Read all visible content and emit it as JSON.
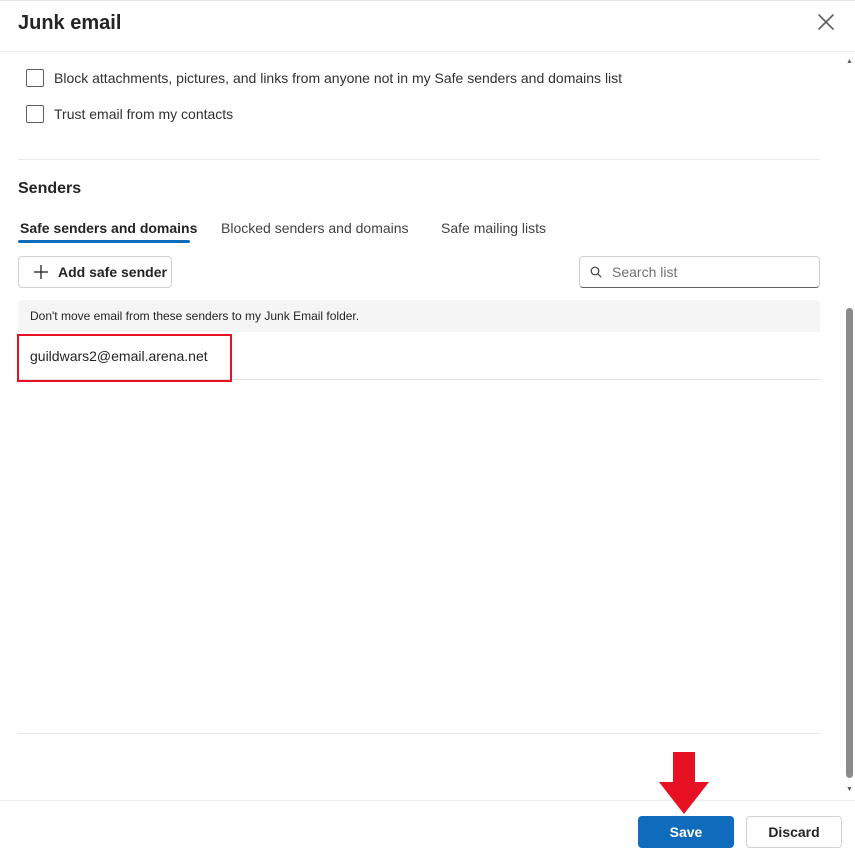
{
  "dialog": {
    "title": "Junk email",
    "close_icon": "close-icon"
  },
  "options": {
    "block_attachments": {
      "label": "Block attachments, pictures, and links from anyone not in my Safe senders and domains list",
      "checked": false
    },
    "trust_contacts": {
      "label": "Trust email from my contacts",
      "checked": false
    }
  },
  "senders": {
    "heading": "Senders",
    "tabs": [
      {
        "label": "Safe senders and domains",
        "active": true
      },
      {
        "label": "Blocked senders and domains",
        "active": false
      },
      {
        "label": "Safe mailing lists",
        "active": false
      }
    ],
    "add_button_label": "Add safe sender",
    "add_icon": "plus-icon",
    "search": {
      "placeholder": "Search list",
      "value": "",
      "icon": "search-icon"
    },
    "list_description": "Don't move email from these senders to my Junk Email folder.",
    "entries": [
      "guildwars2@email.arena.net"
    ]
  },
  "footer": {
    "save_label": "Save",
    "discard_label": "Discard"
  },
  "colors": {
    "accent": "#0f6cbd",
    "annotation_red": "#e81123"
  }
}
